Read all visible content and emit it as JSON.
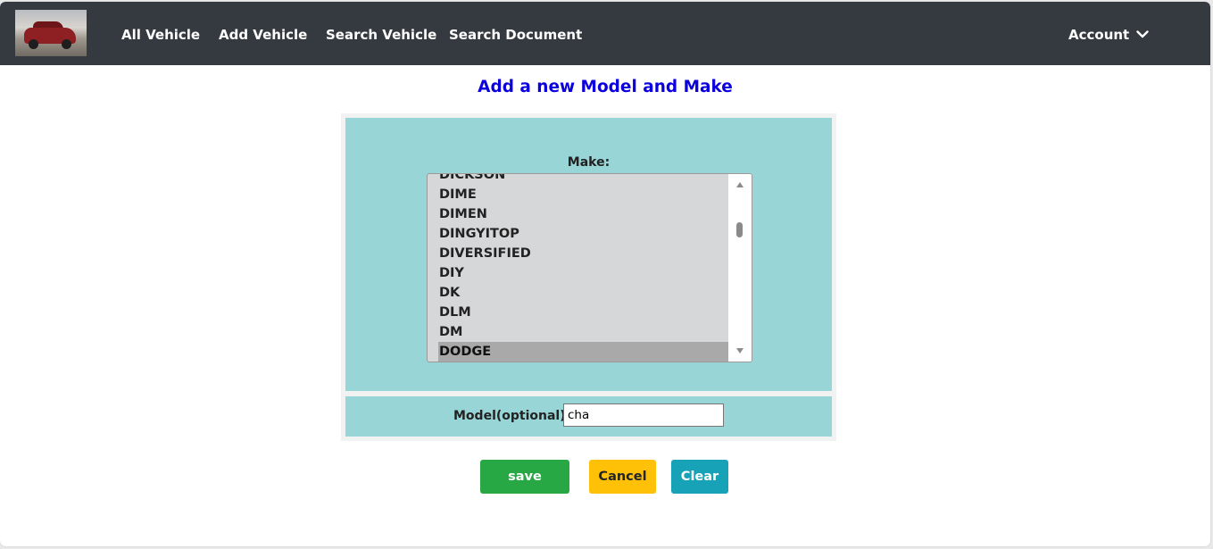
{
  "navbar": {
    "logo_alt": "vehicle-logo",
    "links": [
      "All Vehicle",
      "Add Vehicle",
      "Search Vehicle",
      "Search Document"
    ],
    "account_label": "Account",
    "background": "#343a40"
  },
  "page": {
    "title": "Add a new Model and Make",
    "title_color": "#0b00dd"
  },
  "form": {
    "make_label": "Make:",
    "make_options": [
      "DICKSON",
      "DIME",
      "DIMEN",
      "DINGYITOP",
      "DIVERSIFIED",
      "DIY",
      "DK",
      "DLM",
      "DM",
      "DODGE"
    ],
    "make_selected": "DODGE",
    "model_label": "Model(optional):",
    "model_value": "cha",
    "panel_color": "#98d5d6"
  },
  "buttons": {
    "save_label": "save",
    "cancel_label": "Cancel",
    "clear_label": "Clear"
  }
}
